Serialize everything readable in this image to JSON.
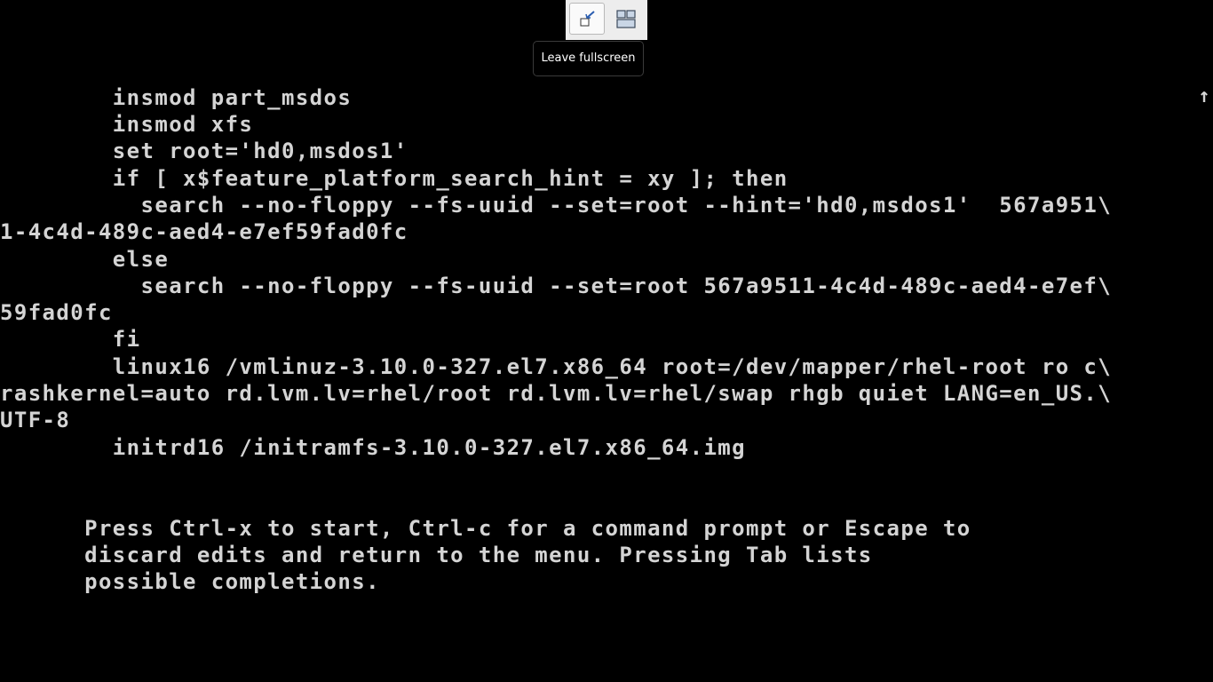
{
  "fullscreen_toolbar": {
    "leave_button_icon": "leave-fullscreen-icon",
    "view_switch_icon": "switch-views-icon",
    "tooltip": "Leave fullscreen"
  },
  "terminal": {
    "scroll_indicator": "↑",
    "lines": [
      "        insmod part_msdos",
      "        insmod xfs",
      "        set root='hd0,msdos1'",
      "        if [ x$feature_platform_search_hint = xy ]; then",
      "          search --no-floppy --fs-uuid --set=root --hint='hd0,msdos1'  567a951\\",
      "1-4c4d-489c-aed4-e7ef59fad0fc",
      "        else",
      "          search --no-floppy --fs-uuid --set=root 567a9511-4c4d-489c-aed4-e7ef\\",
      "59fad0fc",
      "        fi",
      "        linux16 /vmlinuz-3.10.0-327.el7.x86_64 root=/dev/mapper/rhel-root ro c\\",
      "rashkernel=auto rd.lvm.lv=rhel/root rd.lvm.lv=rhel/swap rhgb quiet LANG=en_US.\\",
      "UTF-8",
      "        initrd16 /initramfs-3.10.0-327.el7.x86_64.img"
    ],
    "help_lines": [
      "      Press Ctrl-x to start, Ctrl-c for a command prompt or Escape to",
      "      discard edits and return to the menu. Pressing Tab lists",
      "      possible completions."
    ]
  }
}
